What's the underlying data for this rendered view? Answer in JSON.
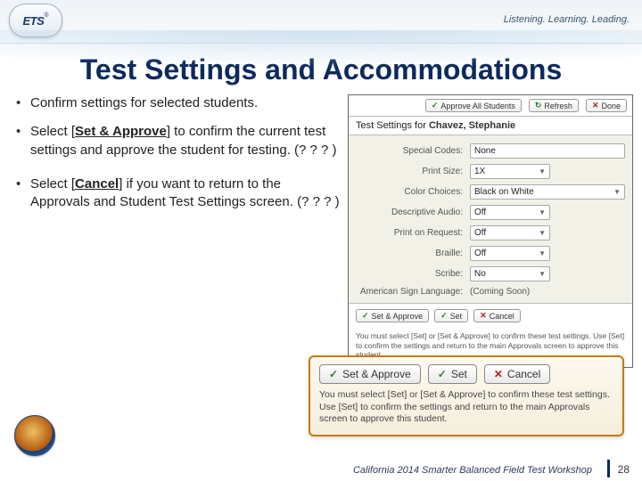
{
  "header": {
    "logo_text": "ETS",
    "logo_r": "®",
    "tagline": "Listening. Learning. Leading."
  },
  "title": "Test Settings and Accommodations",
  "bullets": {
    "b1": "Confirm settings for selected students.",
    "b2_pre": "Select [",
    "b2_btn": "Set & Approve",
    "b2_post": "] to confirm the current test settings and approve the student for testing. (? ? ? )",
    "b3_pre": "Select [",
    "b3_btn": "Cancel",
    "b3_post": "] if you want to return to the Approvals and Student Test Settings screen. (? ? ? )"
  },
  "panel": {
    "topbar": {
      "approve_all": "Approve All Students",
      "refresh": "Refresh",
      "done": "Done"
    },
    "heading_label": "Test Settings for ",
    "student_name": "Chavez, Stephanie",
    "rows": [
      {
        "label": "Special Codes:",
        "value": "None",
        "type": "text"
      },
      {
        "label": "Print Size:",
        "value": "1X",
        "type": "select-small"
      },
      {
        "label": "Color Choices:",
        "value": "Black on White",
        "type": "select"
      },
      {
        "label": "Descriptive Audio:",
        "value": "Off",
        "type": "select-small"
      },
      {
        "label": "Print on Request:",
        "value": "Off",
        "type": "select-small"
      },
      {
        "label": "Braille:",
        "value": "Off",
        "type": "select-small"
      },
      {
        "label": "Scribe:",
        "value": "No",
        "type": "select-small"
      },
      {
        "label": "American Sign Language:",
        "value": "(Coming Soon)",
        "type": "plain"
      }
    ],
    "actions": {
      "set_approve": "Set & Approve",
      "set": "Set",
      "cancel": "Cancel"
    },
    "note": "You must select [Set] or [Set & Approve] to confirm these test settings. Use [Set] to confirm the settings and return to the main Approvals screen to approve this student."
  },
  "callout": {
    "set_approve": "Set & Approve",
    "set": "Set",
    "cancel": "Cancel",
    "note": "You must select [Set] or [Set & Approve] to confirm these test settings. Use [Set] to confirm the settings and return to the main Approvals screen to approve this student."
  },
  "footer": {
    "text": "California 2014 Smarter Balanced Field Test Workshop",
    "page": "28"
  }
}
